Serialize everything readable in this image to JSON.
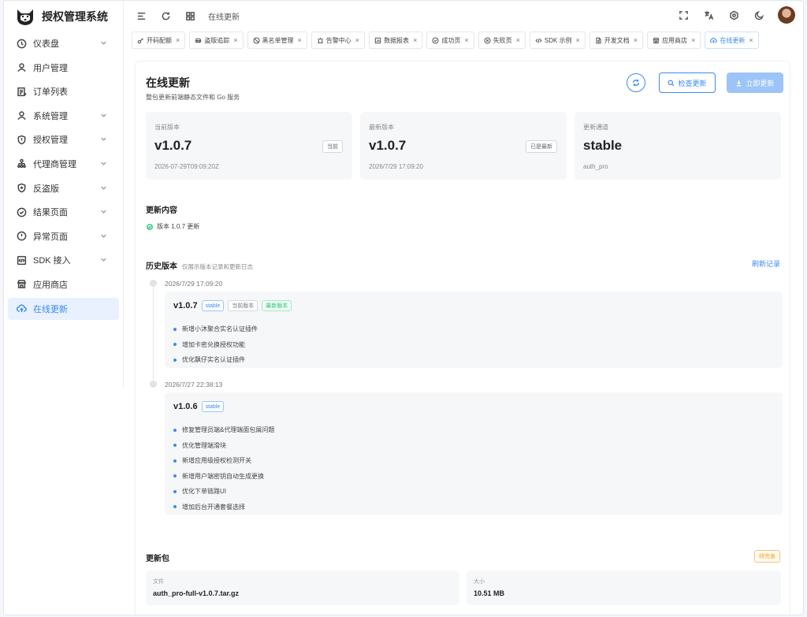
{
  "app": {
    "name": "授权管理系统"
  },
  "sidebar": {
    "items": [
      {
        "label": "仪表盘",
        "icon": "clock-icon",
        "has_children": true
      },
      {
        "label": "用户管理",
        "icon": "user-icon",
        "has_children": false
      },
      {
        "label": "订单列表",
        "icon": "order-list-icon",
        "has_children": false
      },
      {
        "label": "系统管理",
        "icon": "user-icon",
        "has_children": true
      },
      {
        "label": "授权管理",
        "icon": "shield-icon",
        "has_children": true
      },
      {
        "label": "代理商管理",
        "icon": "org-chart-icon",
        "has_children": true
      },
      {
        "label": "反盗版",
        "icon": "shield-plus-icon",
        "has_children": true
      },
      {
        "label": "结果页面",
        "icon": "check-circle-icon",
        "has_children": true
      },
      {
        "label": "异常页面",
        "icon": "alert-circle-icon",
        "has_children": true
      },
      {
        "label": "SDK 接入",
        "icon": "code-square-icon",
        "has_children": true
      },
      {
        "label": "应用商店",
        "icon": "store-icon",
        "has_children": false
      },
      {
        "label": "在线更新",
        "icon": "cloud-upload-icon",
        "has_children": false,
        "active": true
      }
    ]
  },
  "topbar": {
    "breadcrumb": "在线更新"
  },
  "tabs": [
    {
      "label": "开码配额",
      "icon": "key-icon"
    },
    {
      "label": "盗版追踪",
      "icon": "car-icon"
    },
    {
      "label": "黑名单管理",
      "icon": "ban-icon"
    },
    {
      "label": "告警中心",
      "icon": "alarm-icon"
    },
    {
      "label": "数据报表",
      "icon": "report-icon"
    },
    {
      "label": "成功页",
      "icon": "check-circle-icon"
    },
    {
      "label": "失败页",
      "icon": "x-circle-icon"
    },
    {
      "label": "SDK 示例",
      "icon": "code-icon"
    },
    {
      "label": "开发文档",
      "icon": "doc-icon"
    },
    {
      "label": "应用商店",
      "icon": "store-icon"
    },
    {
      "label": "在线更新",
      "icon": "cloud-upload-icon",
      "active": true
    }
  ],
  "page": {
    "title": "在线更新",
    "subtitle": "整包更新前端静态文件和 Go 服务",
    "check_label": "检查更新",
    "update_label": "立即更新"
  },
  "info_cards": {
    "current": {
      "label": "当前版本",
      "value": "v1.0.7",
      "sub": "2026-07-29T09:09:20Z",
      "tag": "当前"
    },
    "latest": {
      "label": "最新版本",
      "value": "v1.0.7",
      "sub": "2026/7/29 17:09:20",
      "tag": "已是最新"
    },
    "channel": {
      "label": "更新通道",
      "value": "stable",
      "sub": "auth_pro"
    }
  },
  "update_content": {
    "title": "更新内容",
    "item": "版本 1.0.7 更新"
  },
  "history": {
    "title": "历史版本",
    "hint": "仅展示版本记录和更新日志",
    "refresh_label": "刷新记录",
    "releases": [
      {
        "date": "2026/7/29 17:09:20",
        "version": "v1.0.7",
        "badges": {
          "channel": "stable",
          "current": "当前版本",
          "latest": "最新版本"
        },
        "notes": [
          "新增小沐聚合实名认证插件",
          "增加卡密兑换授权功能",
          "优化飘仔实名认证插件"
        ]
      },
      {
        "date": "2026/7/27 22:38:13",
        "version": "v1.0.6",
        "badges": {
          "channel": "stable"
        },
        "notes": [
          "修复管理员端&代理端面包屑问题",
          "优化管理端滑块",
          "新增应用级授权检测开关",
          "新增用户端密钥自动生成更换",
          "优化下单链路UI",
          "增加后台开通套餐选择"
        ]
      }
    ]
  },
  "package": {
    "title": "更新包",
    "status": "待完善",
    "file_label": "文件",
    "file_value": "auth_pro-full-v1.0.7.tar.gz",
    "size_label": "大小",
    "size_value": "10.51 MB"
  },
  "colors": {
    "accent": "#3c8af0",
    "success": "#2ec27e",
    "warning": "#f0a020"
  }
}
